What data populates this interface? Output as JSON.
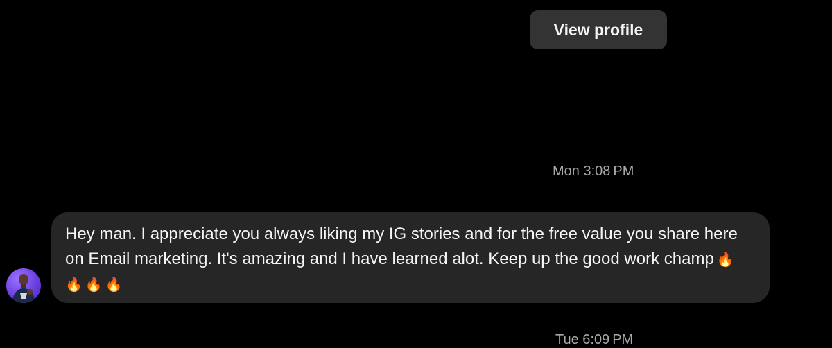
{
  "header": {
    "view_profile_label": "View profile"
  },
  "timestamps": {
    "first": "Mon 3:08 PM",
    "second": "Tue 6:09 PM"
  },
  "message": {
    "text": "Hey man. I appreciate you always liking my IG stories and for the free value you share here on Email marketing. It's amazing and I have learned alot. Keep up the good work champ",
    "emoji": "🔥🔥🔥🔥"
  },
  "avatar": {
    "icon": "user-avatar",
    "accent": "#7a4ff0"
  },
  "colors": {
    "background": "#000000",
    "bubble": "#262626",
    "button": "#333333",
    "timestamp": "#a8a8a8",
    "text": "#f5f5f5"
  }
}
